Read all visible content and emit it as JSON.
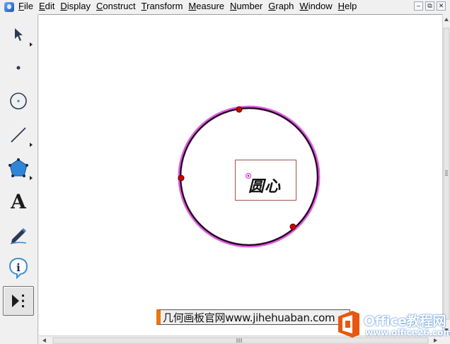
{
  "menubar": {
    "items": [
      "File",
      "Edit",
      "Display",
      "Construct",
      "Transform",
      "Measure",
      "Number",
      "Graph",
      "Window",
      "Help"
    ],
    "window_controls": [
      "–",
      "⧉",
      "✕"
    ]
  },
  "toolbar": {
    "tools": [
      {
        "name": "arrow-tool",
        "icon": "arrow-icon"
      },
      {
        "name": "point-tool",
        "icon": "point-icon"
      },
      {
        "name": "compass-tool",
        "icon": "circle-icon"
      },
      {
        "name": "straightedge-tool",
        "icon": "line-icon"
      },
      {
        "name": "polygon-tool",
        "icon": "polygon-icon"
      },
      {
        "name": "text-tool",
        "icon": "text-icon",
        "glyph": "A"
      },
      {
        "name": "marker-tool",
        "icon": "marker-icon"
      },
      {
        "name": "information-tool",
        "icon": "info-icon",
        "glyph": "i"
      },
      {
        "name": "custom-tool",
        "icon": "custom-tools-icon"
      }
    ]
  },
  "canvas": {
    "label_text": "圆心",
    "circle_color": "#1a0a1a",
    "highlight_color": "#e060e0",
    "point_color": "#cc0000"
  },
  "watermark": {
    "text": "几何画板官网www.jihehuaban.com",
    "logo_title": "Office教程网",
    "logo_url": "www.office26.com"
  }
}
